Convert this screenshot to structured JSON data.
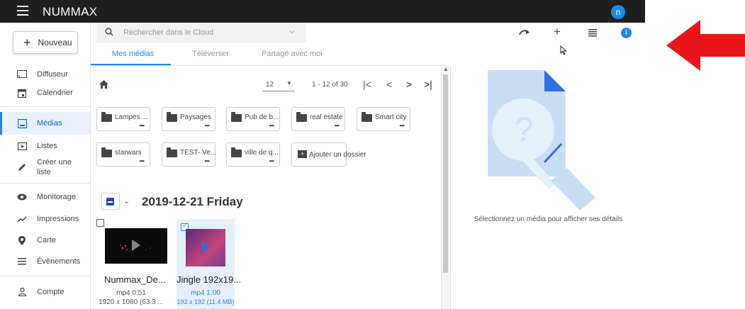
{
  "app": {
    "brand": "NUMMAX",
    "user_initial": "n"
  },
  "sidebar": {
    "new_label": "Nouveau",
    "items": [
      {
        "label": "Diffuseur",
        "icon": "cast-icon"
      },
      {
        "label": "Calendrier",
        "icon": "calendar-icon"
      },
      {
        "label": "Médias",
        "icon": "image-icon",
        "active": true
      },
      {
        "label": "Listes",
        "icon": "playlist-icon"
      },
      {
        "label": "Créer une liste",
        "icon": "pencil-icon"
      },
      {
        "label": "Monitorage",
        "icon": "eye-icon"
      },
      {
        "label": "Impressions",
        "icon": "trending-icon"
      },
      {
        "label": "Carte",
        "icon": "map-pin-icon"
      },
      {
        "label": "Évènements",
        "icon": "list-icon"
      },
      {
        "label": "Compte",
        "icon": "person-icon"
      }
    ]
  },
  "search": {
    "placeholder": "Rechercher dans le Cloud"
  },
  "tabs": [
    {
      "label": "Mes médias",
      "active": true
    },
    {
      "label": "Téléverser"
    },
    {
      "label": "Partagé avec moi"
    }
  ],
  "pager": {
    "per_page": "12",
    "range": "1 - 12 of 30"
  },
  "folders": [
    "Lampes ...",
    "Paysages",
    "Pub de b...",
    "real estate",
    "Smart city",
    "starwars",
    "TEST- Ve...",
    "ville de q..."
  ],
  "add_folder_label": "Ajouter un dossier",
  "date_group": {
    "title": "2019-12-21 Friday"
  },
  "media": [
    {
      "name": "Nummax_De...",
      "type": "mp4 0:51",
      "dims": "1920 x 1080 (63.3 ...",
      "selected": false
    },
    {
      "name": "Jingle 192x19...",
      "type": "mp4 1:00",
      "dims": "192 x 192 (11.4 MB)",
      "selected": true
    }
  ],
  "detail": {
    "empty_message": "Sélectionnez un média pour afficher ses détails"
  },
  "colors": {
    "accent": "#1e88e5",
    "topbar": "#1f1f1f",
    "annotation_arrow": "#e8161b"
  }
}
